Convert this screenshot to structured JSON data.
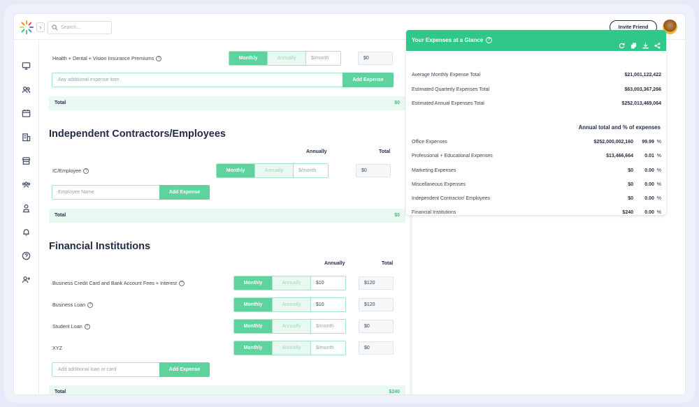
{
  "topbar": {
    "search_placeholder": "Search...",
    "invite_label": "Invite Friend",
    "collapse_glyph": "›"
  },
  "sidebar": {
    "icons": [
      "monitor-icon",
      "users-icon",
      "calendar-icon",
      "building-icon",
      "store-icon",
      "people-icon",
      "bank-icon",
      "bell-icon",
      "help-icon",
      "add-user-icon"
    ]
  },
  "insurance": {
    "label": "Health + Dental + Vision Insurance Premiums",
    "monthly": "Monthly",
    "annually": "Annually",
    "per_month_placeholder": "$/month",
    "amount": "$0",
    "add_placeholder": "Any additional expense item",
    "add_label": "Add Expense",
    "total_label": "Total",
    "total_value": "$0"
  },
  "contractors": {
    "title": "Independent Contractors/Employees",
    "col_annually": "Annually",
    "col_total": "Total",
    "row_label": "IC/Employee",
    "monthly": "Monthly",
    "annually": "Annually",
    "per_month_placeholder": "$/month",
    "amount": "$0",
    "add_placeholder": "Employee Name",
    "add_label": "Add Expense",
    "total_label": "Total",
    "total_value": "$0"
  },
  "financial": {
    "title": "Financial Institutions",
    "col_annually": "Annually",
    "col_total": "Total",
    "monthly": "Monthly",
    "annually": "Annually",
    "rows": [
      {
        "label": "Business Credit Card and Bank Account Fees + Interest",
        "per_month": "$10",
        "total": "$120"
      },
      {
        "label": "Business Loan",
        "per_month": "$10",
        "total": "$120"
      },
      {
        "label": "Student Loan",
        "per_month": "$/month",
        "total": "$0"
      },
      {
        "label": "XYZ",
        "per_month": "$/month",
        "total": "$0"
      }
    ],
    "add_placeholder": "Add additional loan or card",
    "add_label": "Add Expense",
    "total_label": "Total",
    "total_value": "$240"
  },
  "glance": {
    "title": "Your Expenses at a Glance",
    "summary": [
      {
        "label": "Average Monthly Expense Total",
        "value": "$21,001,122,422"
      },
      {
        "label": "Estimated Quarterly Expenses Total",
        "value": "$63,003,367,266"
      },
      {
        "label": "Estimated Annual Expenses Total",
        "value": "$252,013,469,064"
      }
    ],
    "annual_header": "Annual total and % of expenses",
    "categories": [
      {
        "label": "Office Expenses",
        "amount": "$252,000,002,160",
        "pct": "99.99",
        "pct_sign": "%"
      },
      {
        "label": "Professional + Educational Expenses",
        "amount": "$13,466,664",
        "pct": "0.01",
        "pct_sign": "%"
      },
      {
        "label": "Marketing Expenses",
        "amount": "$0",
        "pct": "0.00",
        "pct_sign": "%"
      },
      {
        "label": "Miscellaneous Expenses",
        "amount": "$0",
        "pct": "0.00",
        "pct_sign": "%"
      },
      {
        "label": "Independent Contractor/ Employees",
        "amount": "$0",
        "pct": "0.00",
        "pct_sign": "%"
      },
      {
        "label": "Financial Institutions",
        "amount": "$240",
        "pct": "0.00",
        "pct_sign": "%"
      }
    ]
  },
  "colors": {
    "accent": "#5fd39e",
    "header_green": "#2fc78a",
    "total_green": "#39c381",
    "navy": "#1f2a44"
  }
}
